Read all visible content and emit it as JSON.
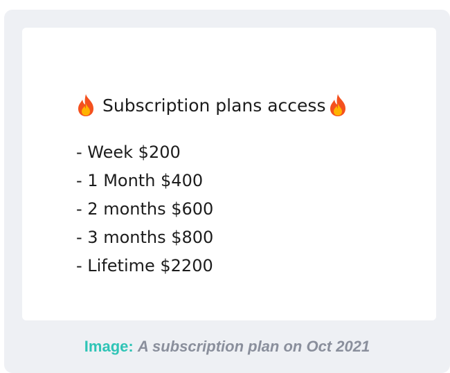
{
  "card": {
    "title": "Subscription plans access",
    "title_icon": "fire-icon",
    "plans": [
      "- Week $200",
      "- 1 Month $400",
      "- 2 months $600",
      "- 3 months $800",
      "- Lifetime $2200"
    ]
  },
  "caption": {
    "label": "Image:",
    "text": "A subscription plan on Oct 2021"
  },
  "colors": {
    "frame_background": "#eef0f4",
    "caption_label": "#2ec4b6",
    "caption_text": "#8a8f9c"
  }
}
